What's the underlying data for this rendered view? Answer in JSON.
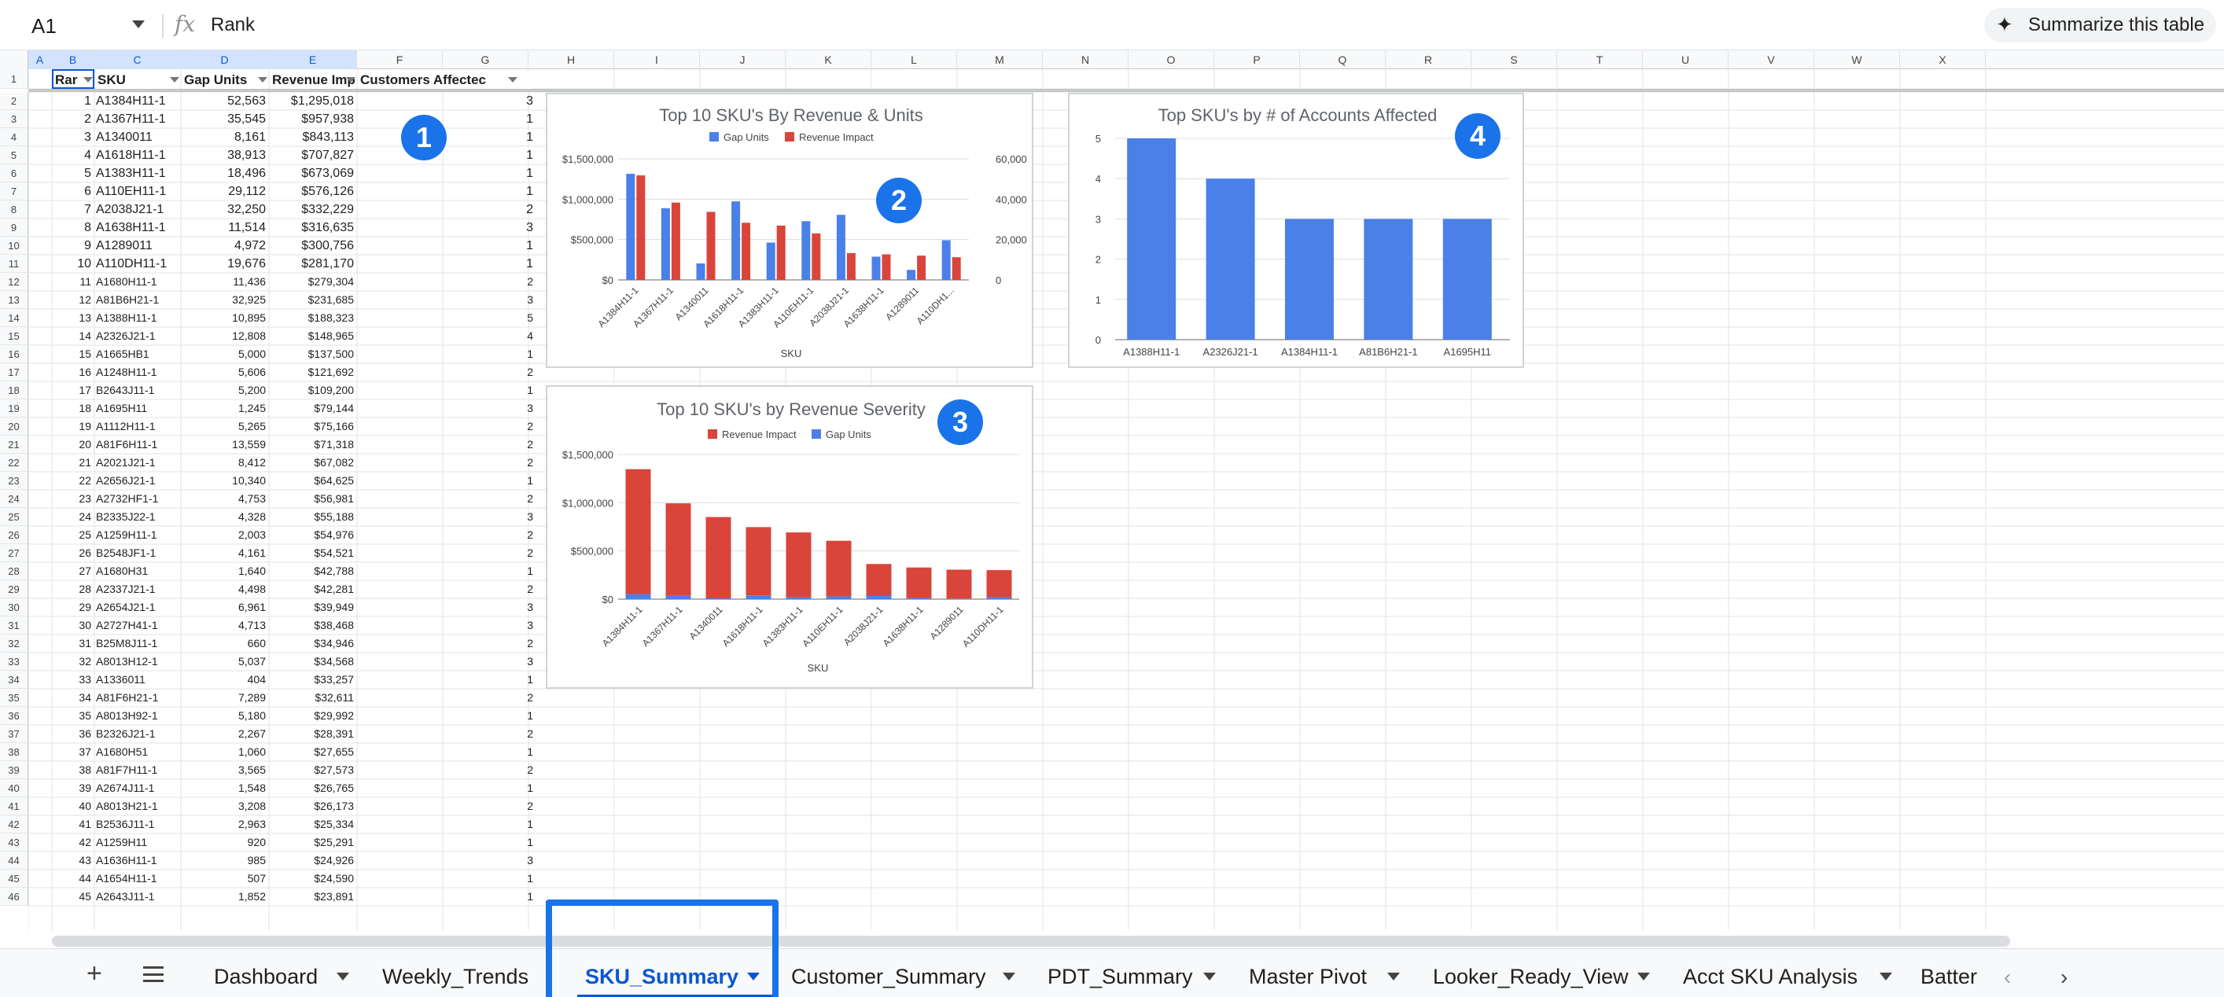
{
  "formula_bar": {
    "cell_ref": "A1",
    "fx_label": "fx",
    "value": "Rank",
    "summarize_label": "Summarize this table",
    "sparkle_icon": "sparkle-icon"
  },
  "columns": [
    "A",
    "B",
    "C",
    "D",
    "E",
    "F",
    "G",
    "H",
    "I",
    "J",
    "K",
    "L",
    "M",
    "N",
    "O",
    "P",
    "Q",
    "R",
    "S",
    "T",
    "U",
    "V",
    "W",
    "X"
  ],
  "table": {
    "headers": [
      "Rar",
      "SKU",
      "Gap Units",
      "Revenue Impact",
      "Customers Affectec"
    ],
    "rows": [
      [
        "1",
        "A1384H11-1",
        "52,563",
        "$1,295,018",
        "3"
      ],
      [
        "2",
        "A1367H11-1",
        "35,545",
        "$957,938",
        "1"
      ],
      [
        "3",
        "A1340011",
        "8,161",
        "$843,113",
        "1"
      ],
      [
        "4",
        "A1618H11-1",
        "38,913",
        "$707,827",
        "1"
      ],
      [
        "5",
        "A1383H11-1",
        "18,496",
        "$673,069",
        "1"
      ],
      [
        "6",
        "A110EH11-1",
        "29,112",
        "$576,126",
        "1"
      ],
      [
        "7",
        "A2038J21-1",
        "32,250",
        "$332,229",
        "2"
      ],
      [
        "8",
        "A1638H11-1",
        "11,514",
        "$316,635",
        "3"
      ],
      [
        "9",
        "A1289011",
        "4,972",
        "$300,756",
        "1"
      ],
      [
        "10",
        "A110DH11-1",
        "19,676",
        "$281,170",
        "1"
      ],
      [
        "11",
        "A1680H11-1",
        "11,436",
        "$279,304",
        "2"
      ],
      [
        "12",
        "A81B6H21-1",
        "32,925",
        "$231,685",
        "3"
      ],
      [
        "13",
        "A1388H11-1",
        "10,895",
        "$188,323",
        "5"
      ],
      [
        "14",
        "A2326J21-1",
        "12,808",
        "$148,965",
        "4"
      ],
      [
        "15",
        "A1665HB1",
        "5,000",
        "$137,500",
        "1"
      ],
      [
        "16",
        "A1248H11-1",
        "5,606",
        "$121,692",
        "2"
      ],
      [
        "17",
        "B2643J11-1",
        "5,200",
        "$109,200",
        "1"
      ],
      [
        "18",
        "A1695H11",
        "1,245",
        "$79,144",
        "3"
      ],
      [
        "19",
        "A1112H11-1",
        "5,265",
        "$75,166",
        "2"
      ],
      [
        "20",
        "A81F6H11-1",
        "13,559",
        "$71,318",
        "2"
      ],
      [
        "21",
        "A2021J21-1",
        "8,412",
        "$67,082",
        "2"
      ],
      [
        "22",
        "A2656J21-1",
        "10,340",
        "$64,625",
        "1"
      ],
      [
        "23",
        "A2732HF1-1",
        "4,753",
        "$56,981",
        "2"
      ],
      [
        "24",
        "B2335J22-1",
        "4,328",
        "$55,188",
        "3"
      ],
      [
        "25",
        "A1259H11-1",
        "2,003",
        "$54,976",
        "2"
      ],
      [
        "26",
        "B2548JF1-1",
        "4,161",
        "$54,521",
        "2"
      ],
      [
        "27",
        "A1680H31",
        "1,640",
        "$42,788",
        "1"
      ],
      [
        "28",
        "A2337J21-1",
        "4,498",
        "$42,281",
        "2"
      ],
      [
        "29",
        "A2654J21-1",
        "6,961",
        "$39,949",
        "3"
      ],
      [
        "30",
        "A2727H41-1",
        "4,713",
        "$38,468",
        "3"
      ],
      [
        "31",
        "B25M8J11-1",
        "660",
        "$34,946",
        "2"
      ],
      [
        "32",
        "A8013H12-1",
        "5,037",
        "$34,568",
        "3"
      ],
      [
        "33",
        "A1336011",
        "404",
        "$33,257",
        "1"
      ],
      [
        "34",
        "A81F6H21-1",
        "7,289",
        "$32,611",
        "2"
      ],
      [
        "35",
        "A8013H92-1",
        "5,180",
        "$29,992",
        "1"
      ],
      [
        "36",
        "B2326J21-1",
        "2,267",
        "$28,391",
        "2"
      ],
      [
        "37",
        "A1680H51",
        "1,060",
        "$27,655",
        "1"
      ],
      [
        "38",
        "A81F7H11-1",
        "3,565",
        "$27,573",
        "2"
      ],
      [
        "39",
        "A2674J11-1",
        "1,548",
        "$26,765",
        "1"
      ],
      [
        "40",
        "A8013H21-1",
        "3,208",
        "$26,173",
        "2"
      ],
      [
        "41",
        "B2536J11-1",
        "2,963",
        "$25,334",
        "1"
      ],
      [
        "42",
        "A1259H11",
        "920",
        "$25,291",
        "1"
      ],
      [
        "43",
        "A1636H11-1",
        "985",
        "$24,926",
        "3"
      ],
      [
        "44",
        "A1654H11-1",
        "507",
        "$24,590",
        "1"
      ],
      [
        "45",
        "A2643J11-1",
        "1,852",
        "$23,891",
        "1"
      ]
    ]
  },
  "chart_data": [
    {
      "type": "bar",
      "title": "Top 10 SKU's By Revenue & Units",
      "xlabel": "SKU",
      "categories": [
        "A1384H11-1",
        "A1367H11-1",
        "A1340011",
        "A1618H11-1",
        "A1383H11-1",
        "A110EH11-1",
        "A2038J21-1",
        "A1638H11-1",
        "A1289011",
        "A110DH1..."
      ],
      "series": [
        {
          "name": "Gap Units",
          "axis": "right",
          "color": "#4a80e8",
          "values": [
            52563,
            35545,
            8161,
            38913,
            18496,
            29112,
            32250,
            11514,
            4972,
            19676
          ]
        },
        {
          "name": "Revenue Impact",
          "axis": "left",
          "color": "#d9453a",
          "values": [
            1295018,
            957938,
            843113,
            707827,
            673069,
            576126,
            332229,
            316635,
            300756,
            281170
          ]
        }
      ],
      "y_left_ticks": [
        "$1,500,000",
        "$1,000,000",
        "$500,000",
        "$0"
      ],
      "y_right_ticks": [
        "60,000",
        "40,000",
        "20,000",
        "0"
      ],
      "ylim_left": [
        0,
        1500000
      ],
      "ylim_right": [
        0,
        60000
      ],
      "legend": "top",
      "badge": "2"
    },
    {
      "type": "bar",
      "stacked": true,
      "title": "Top 10 SKU's by Revenue Severity",
      "xlabel": "SKU",
      "categories": [
        "A1384H11-1",
        "A1367H11-1",
        "A1340011",
        "A1618H11-1",
        "A1383H11-1",
        "A110EH11-1",
        "A2038J21-1",
        "A1638H11-1",
        "A1289011",
        "A110DH11-1"
      ],
      "series": [
        {
          "name": "Revenue Impact",
          "color": "#d9453a",
          "values": [
            1295018,
            957938,
            843113,
            707827,
            673069,
            576126,
            332229,
            316635,
            300756,
            281170
          ]
        },
        {
          "name": "Gap Units",
          "color": "#4a80e8",
          "values": [
            52563,
            35545,
            8161,
            38913,
            18496,
            29112,
            32250,
            11514,
            4972,
            19676
          ]
        }
      ],
      "y_ticks": [
        "$1,500,000",
        "$1,000,000",
        "$500,000",
        "$0"
      ],
      "ylim": [
        0,
        1500000
      ],
      "legend": "top",
      "badge": "3"
    },
    {
      "type": "bar",
      "title": "Top  SKU's by # of Accounts Affected",
      "categories": [
        "A1388H11-1",
        "A2326J21-1",
        "A1384H11-1",
        "A81B6H21-1",
        "A1695H11"
      ],
      "series": [
        {
          "name": "",
          "color": "#4a80e8",
          "values": [
            5,
            4,
            3,
            3,
            3
          ]
        }
      ],
      "y_ticks": [
        "5",
        "4",
        "3",
        "2",
        "1",
        "0"
      ],
      "ylim": [
        0,
        5
      ],
      "badge": "4"
    }
  ],
  "table_badge": "1",
  "sheet_tabs": {
    "add_icon": "plus-icon",
    "menu_icon": "menu-icon",
    "tabs": [
      "Dashboard",
      "Weekly_Trends",
      "SKU_Summary",
      "Customer_Summary",
      "PDT_Summary",
      "Master Pivot",
      "Looker_Ready_View",
      "Acct SKU Analysis",
      "Batter"
    ],
    "active": "SKU_Summary",
    "prev_icon": "chevron-left-icon",
    "next_icon": "chevron-right-icon"
  }
}
